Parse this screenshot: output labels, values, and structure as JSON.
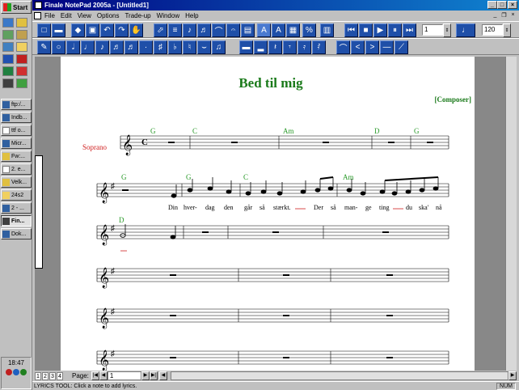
{
  "taskbar": {
    "start_label": "Start",
    "buttons": [
      {
        "label": "ftp:/..."
      },
      {
        "label": "Indb..."
      },
      {
        "label": "ttf o..."
      },
      {
        "label": "Micr..."
      },
      {
        "label": "Fw:..."
      },
      {
        "label": "2. e..."
      },
      {
        "label": "Velk..."
      },
      {
        "label": "24s2"
      },
      {
        "label": "2 - ..."
      },
      {
        "label": "Fin..."
      },
      {
        "label": "Dok..."
      }
    ],
    "clock": "18:47"
  },
  "window": {
    "title": "Finale NotePad 2005a - [Untitled1]",
    "controls": {
      "minimize": "_",
      "maximize": "□",
      "close": "×"
    }
  },
  "menu": {
    "items": [
      "File",
      "Edit",
      "View",
      "Options",
      "Trade-up",
      "Window",
      "Help"
    ]
  },
  "toolbar": {
    "measure_value": "1",
    "tempo_value": "120"
  },
  "score": {
    "title": "Bed til mig",
    "composer": "[Composer]",
    "instrument": "Soprano",
    "chords_system1": [
      "G",
      "C",
      "Am",
      "D",
      "G"
    ],
    "chords_system2": [
      "G",
      "G",
      "C",
      "Am"
    ],
    "chords_system3": [
      "D"
    ],
    "lyrics": [
      "Din",
      "hver-",
      "dag",
      "den",
      "går",
      "så",
      "stærkt.",
      "Der",
      "så",
      "man-",
      "ge",
      "ting",
      "du",
      "ska'",
      "nå"
    ]
  },
  "pagebar": {
    "tabs": [
      "1",
      "2",
      "3",
      "4"
    ],
    "page_label": "Page:",
    "page_value": "1"
  },
  "status": {
    "text": "LYRICS TOOL: Click a note to add lyrics.",
    "num": "NUM"
  },
  "colors": {
    "title_green": "#1a7a1a",
    "chord_green": "#2a9a2a",
    "instrument_red": "#d02020",
    "titlebar_blue": "#000080"
  }
}
